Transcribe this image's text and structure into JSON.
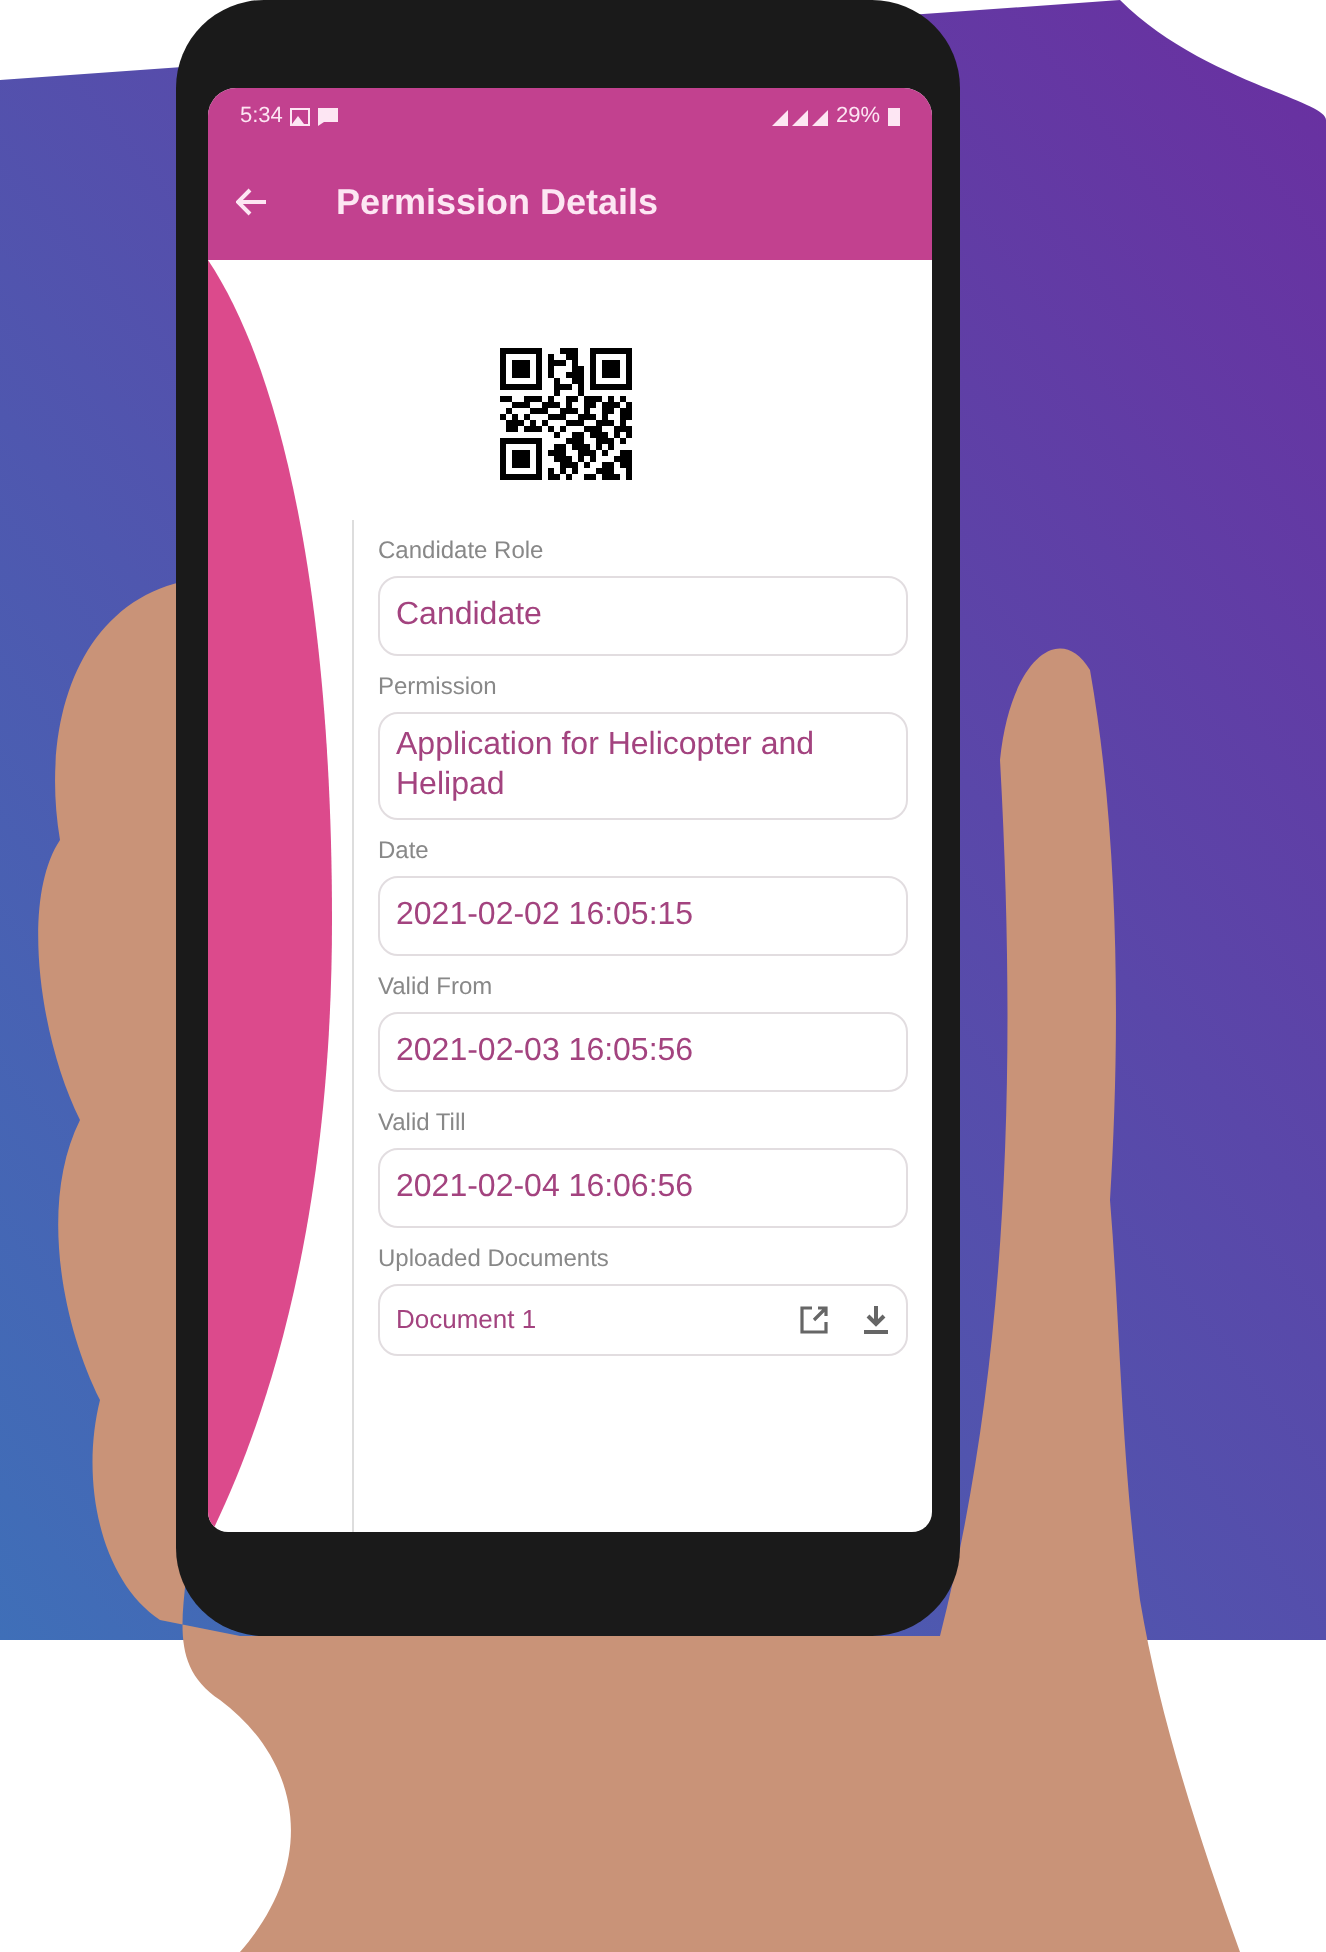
{
  "status_bar": {
    "time": "5:34",
    "battery": "29%"
  },
  "app_bar": {
    "title": "Permission Details"
  },
  "fields": [
    {
      "label": "Candidate Role",
      "value": "Candidate"
    },
    {
      "label": "Permission",
      "value": "Application for Helicopter and Helipad"
    },
    {
      "label": "Date",
      "value": "2021-02-02 16:05:15"
    },
    {
      "label": "Valid From",
      "value": "2021-02-03 16:05:56"
    },
    {
      "label": "Valid Till",
      "value": "2021-02-04 16:06:56"
    }
  ],
  "documents": {
    "label": "Uploaded Documents",
    "items": [
      {
        "name": "Document 1"
      }
    ]
  }
}
